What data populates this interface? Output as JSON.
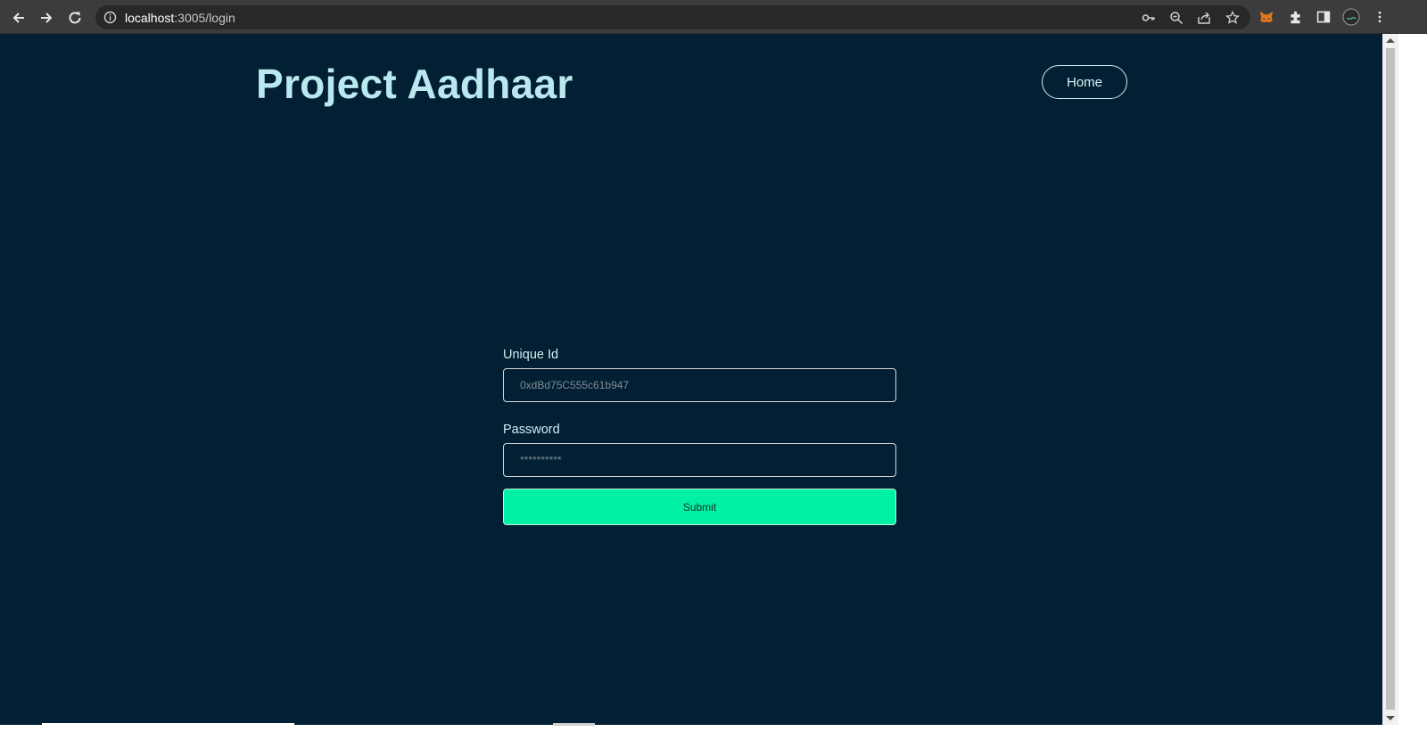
{
  "browser": {
    "url_host": "localhost",
    "url_rest": ":3005/login",
    "icons": [
      "back-icon",
      "forward-icon",
      "reload-icon",
      "site-info-icon",
      "key-icon",
      "zoom-icon",
      "share-icon",
      "bookmark-star-icon",
      "metamask-fox-icon",
      "extensions-puzzle-icon",
      "side-panel-icon",
      "profile-avatar-icon",
      "menu-kebab-icon"
    ]
  },
  "header": {
    "brand": "Project Aadhaar",
    "home_label": "Home"
  },
  "form": {
    "unique_id_label": "Unique Id",
    "unique_id_placeholder": "0xdBd75C555c61b947",
    "password_label": "Password",
    "password_placeholder": "**********",
    "submit_label": "Submit"
  },
  "colors": {
    "background": "#021f33",
    "brand_text": "#b9e8ee",
    "submit_bg": "#00f0a4"
  }
}
